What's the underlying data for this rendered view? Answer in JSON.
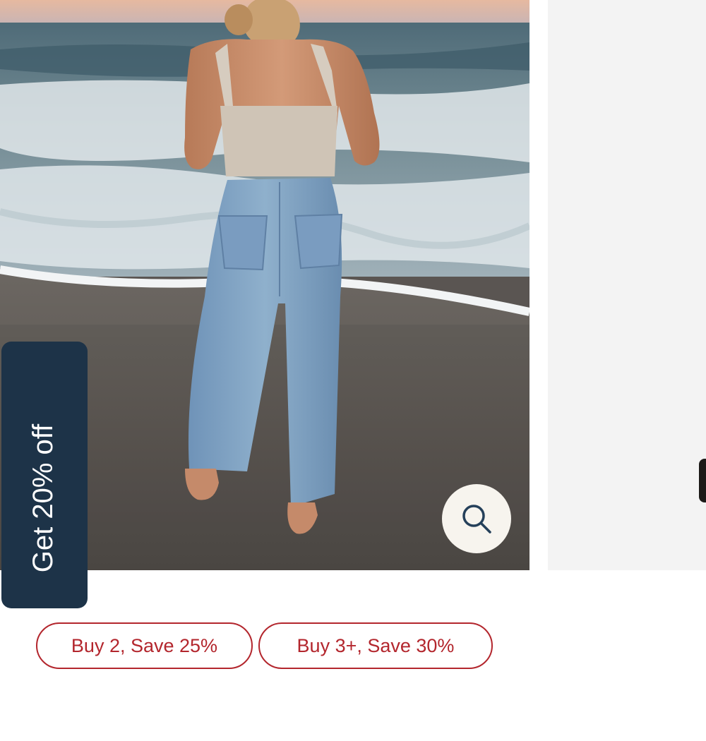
{
  "product_gallery": {
    "main_image": "woman in cream crop top and light-wash jeans standing barefoot on a beach facing the ocean",
    "next_image": "product shot on white background",
    "zoom_icon": "search-icon"
  },
  "promo_tab": {
    "label": "Get 20% off",
    "close_icon": "close-icon",
    "background_color": "#1d3348",
    "text_color": "#ffffff"
  },
  "offers": [
    {
      "label": "Buy 2, Save 25%"
    },
    {
      "label": "Buy 3+, Save 30%"
    }
  ],
  "colors": {
    "offer_accent": "#b3262d",
    "zoom_button_bg": "#f7f4ee"
  }
}
